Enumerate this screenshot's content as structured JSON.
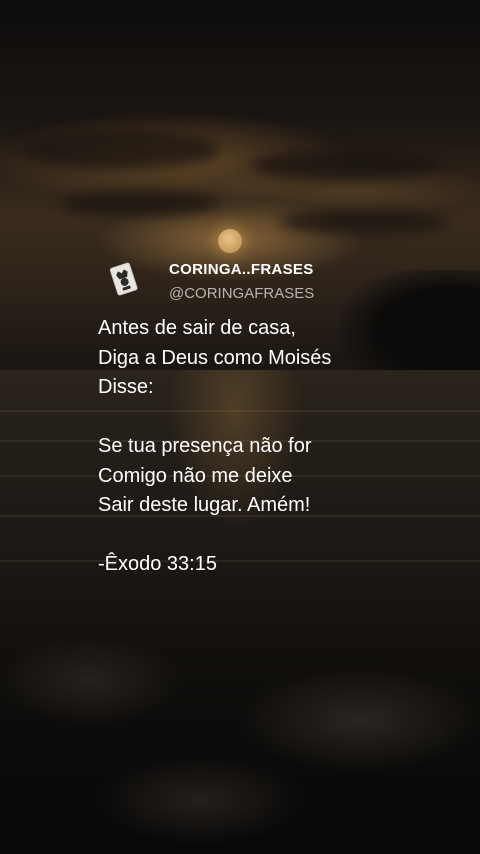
{
  "post": {
    "account_name": "CORINGA..FRASES",
    "account_handle": "@CORINGAFRASES",
    "avatar_icon": "joker-card-icon",
    "quote_lines": [
      "Antes de sair de casa,",
      "Diga a Deus como Moisés",
      "Disse:",
      "",
      "Se tua presença não for",
      "Comigo não me deixe",
      "Sair deste lugar. Amém!",
      "",
      "-Êxodo 33:15"
    ]
  },
  "background": {
    "scene": "moonlit-sea-at-dusk",
    "colors": {
      "sky_dark": "#0e0d0c",
      "cloud_glow": "#b98a48",
      "sea": "#1f1b16"
    }
  }
}
